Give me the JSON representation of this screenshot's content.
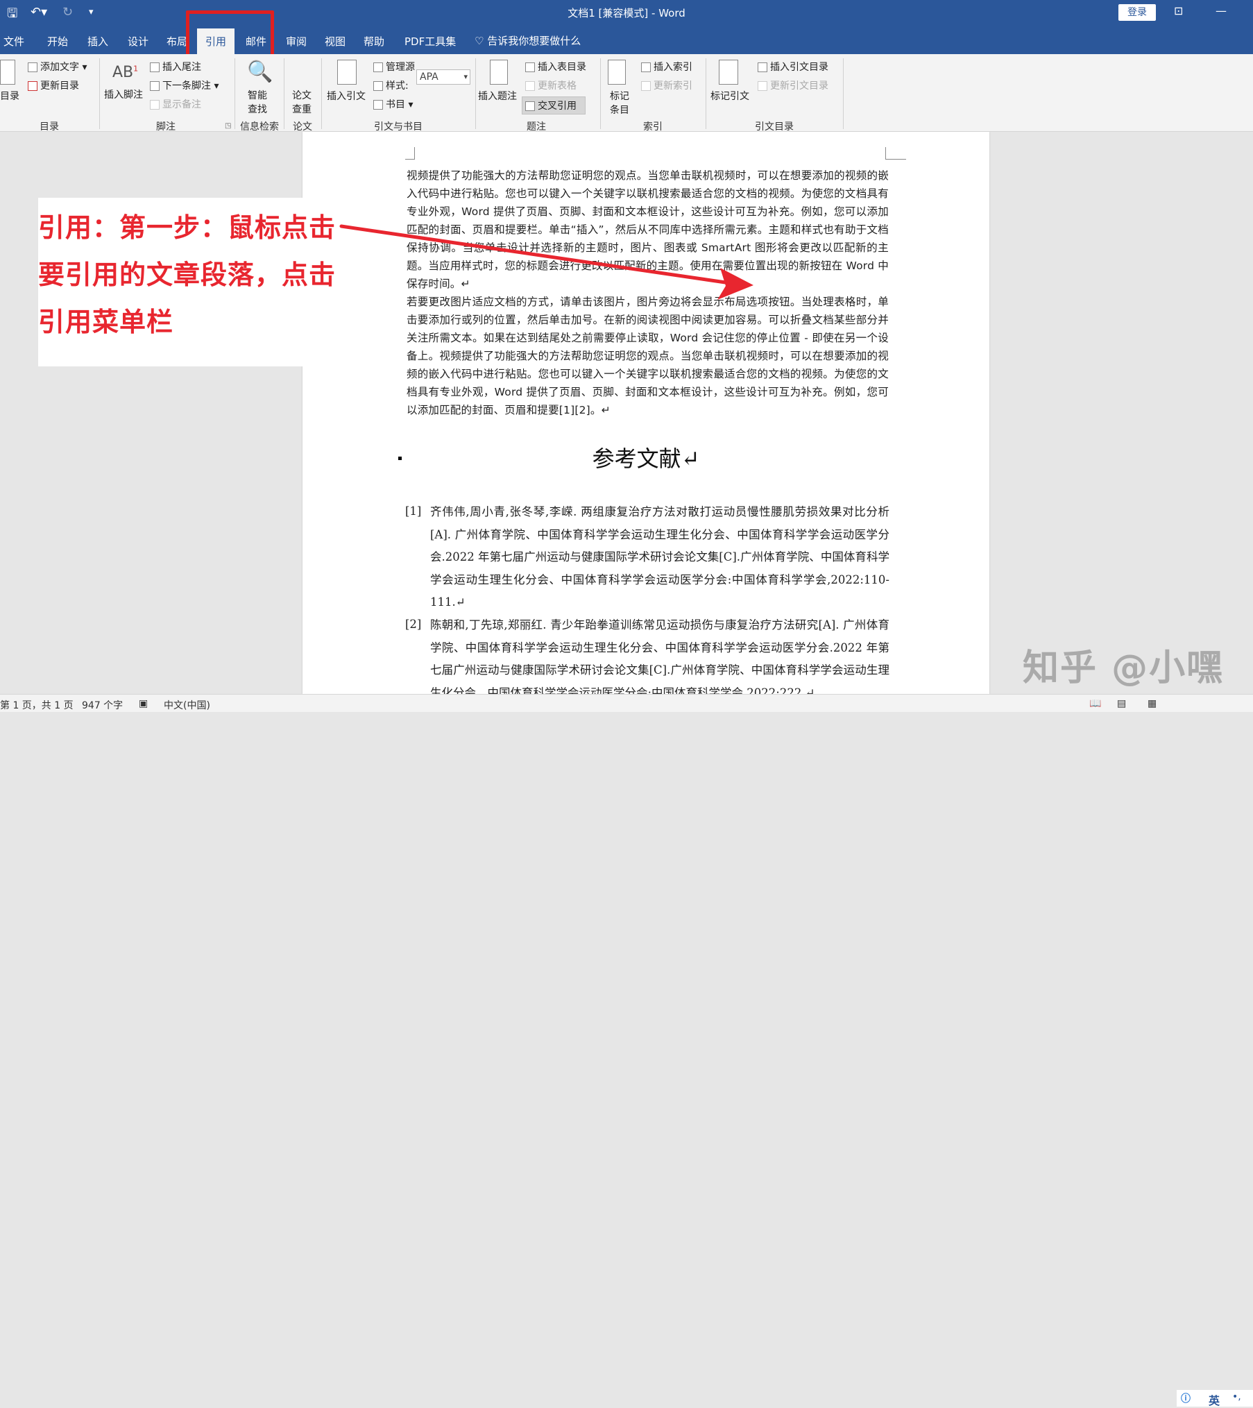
{
  "window": {
    "title": "文档1 [兼容模式] - Word",
    "login_label": "登录"
  },
  "tabs": [
    {
      "label": "文件"
    },
    {
      "label": "开始"
    },
    {
      "label": "插入"
    },
    {
      "label": "设计"
    },
    {
      "label": "布局"
    },
    {
      "label": "引用"
    },
    {
      "label": "邮件"
    },
    {
      "label": "审阅"
    },
    {
      "label": "视图"
    },
    {
      "label": "帮助"
    },
    {
      "label": "PDF工具集"
    }
  ],
  "tell_me": "告诉我你想要做什么",
  "ribbon": {
    "toc": {
      "big_label": "目录",
      "add_text": "添加文字",
      "update_toc": "更新目录",
      "group": "目录"
    },
    "footnotes": {
      "insert_footnote": "插入脚注",
      "insert_endnote": "插入尾注",
      "next_footnote": "下一条脚注",
      "show_notes": "显示备注",
      "group": "脚注"
    },
    "research": {
      "smart_lookup_1": "智能",
      "smart_lookup_2": "查找",
      "group": "信息检索"
    },
    "paper": {
      "check_1": "论文",
      "check_2": "查重",
      "group": "论文"
    },
    "citations": {
      "insert_citation": "插入引文",
      "manage_sources": "管理源",
      "style_label": "样式:",
      "style_value": "APA",
      "bibliography": "书目",
      "group": "引文与书目"
    },
    "captions": {
      "insert_caption": "插入题注",
      "insert_tof": "插入表目录",
      "update_table": "更新表格",
      "cross_reference": "交叉引用",
      "group": "题注"
    },
    "index": {
      "mark_entry_1": "标记",
      "mark_entry_2": "条目",
      "insert_index": "插入索引",
      "update_index": "更新索引",
      "group": "索引"
    },
    "toa": {
      "mark_citation": "标记引文",
      "insert_toa": "插入引文目录",
      "update_toa": "更新引文目录",
      "group": "引文目录"
    }
  },
  "document": {
    "body_1": "视频提供了功能强大的方法帮助您证明您的观点。当您单击联机视频时，可以在想要添加的视频的嵌入代码中进行粘贴。您也可以键入一个关键字以联机搜索最适合您的文档的视频。为使您的文档具有专业外观，Word 提供了页眉、页脚、封面和文本框设计，这些设计可互为补充。例如，您可以添加匹配的封面、页眉和提要栏。单击“插入”，然后从不同库中选择所需元素。主题和样式也有助于文档保持协调。当您单击设计并选择新的主题时，图片、图表或 SmartArt 图形将会更改以匹配新的主题。当应用样式时，您的标题会进行更改以匹配新的主题。使用在需要位置出现的新按钮在 Word 中保存时间。↵",
    "body_2": "若要更改图片适应文档的方式，请单击该图片，图片旁边将会显示布局选项按钮。当处理表格时，单击要添加行或列的位置，然后单击加号。在新的阅读视图中阅读更加容易。可以折叠文档某些部分并关注所需文本。如果在达到结尾处之前需要停止读取，Word 会记住您的停止位置 - 即使在另一个设备上。视频提供了功能强大的方法帮助您证明您的观点。当您单击联机视频时，可以在想要添加的视频的嵌入代码中进行粘贴。您也可以键入一个关键字以联机搜索最适合您的文档的视频。为使您的文档具有专业外观，Word 提供了页眉、页脚、封面和文本框设计，这些设计可互为补充。例如，您可以添加匹配的封面、页眉和提要[1][2]。↵",
    "ref_heading": "参考文献↵",
    "references": [
      {
        "num": "[1]",
        "text": "齐伟伟,周小青,张冬琴,李嵘. 两组康复治疗方法对散打运动员慢性腰肌劳损效果对比分析[A]. 广州体育学院、中国体育科学学会运动生理生化分会、中国体育科学学会运动医学分会.2022 年第七届广州运动与健康国际学术研讨会论文集[C].广州体育学院、中国体育科学学会运动生理生化分会、中国体育科学学会运动医学分会:中国体育科学学会,2022:110-111.↵"
      },
      {
        "num": "[2]",
        "text": "陈朝和,丁先琼,郑丽红. 青少年跆拳道训练常见运动损伤与康复治疗方法研究[A]. 广州体育学院、中国体育科学学会运动生理生化分会、中国体育科学学会运动医学分会.2022 年第七届广州运动与健康国际学术研讨会论文集[C].广州体育学院、中国体育科学学会运动生理生化分会、中国体育科学学会运动医学分会:中国体育科学学会,2022:222.↵"
      }
    ]
  },
  "callout": {
    "line1": "引用：第一步：鼠标点击",
    "line2": "要引用的文章段落，点击",
    "line3": "引用菜单栏"
  },
  "watermark": "知乎 @小嘿",
  "status": {
    "page": "第 1 页，共 1 页",
    "words": "947 个字",
    "language": "中文(中国)",
    "ime": "英"
  },
  "colors": {
    "ribbon_blue": "#2b579a",
    "annotation_red": "#e8262f"
  }
}
